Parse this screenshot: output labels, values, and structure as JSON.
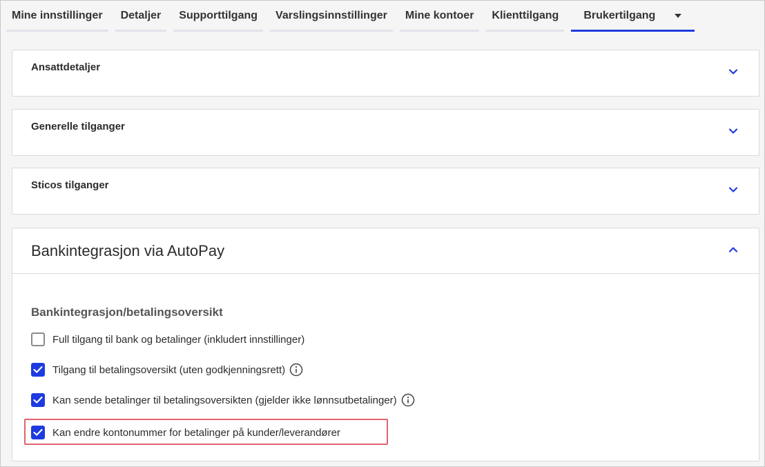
{
  "tabs": [
    {
      "label": "Mine innstillinger"
    },
    {
      "label": "Detaljer"
    },
    {
      "label": "Supporttilgang"
    },
    {
      "label": "Varslingsinnstillinger"
    },
    {
      "label": "Mine kontoer"
    },
    {
      "label": "Klienttilgang"
    },
    {
      "label": "Brukertilgang",
      "active": true
    }
  ],
  "panels": [
    {
      "title": "Ansattdetaljer",
      "expanded": false
    },
    {
      "title": "Generelle tilganger",
      "expanded": false
    },
    {
      "title": "Sticos tilganger",
      "expanded": false
    }
  ],
  "autopay": {
    "title": "Bankintegrasjon via AutoPay",
    "expanded": true,
    "section_title": "Bankintegrasjon/betalingsoversikt",
    "options": [
      {
        "label": "Full tilgang til bank og betalinger (inkludert innstillinger)",
        "checked": false,
        "info": false
      },
      {
        "label": "Tilgang til betalingsoversikt (uten godkjenningsrett)",
        "checked": true,
        "info": true
      },
      {
        "label": "Kan sende betalinger til betalingsoversikten (gjelder ikke lønnsutbetalinger)",
        "checked": true,
        "info": true
      },
      {
        "label": "Kan endre kontonummer for betalinger på kunder/leverandører",
        "checked": true,
        "info": false,
        "highlighted": true
      }
    ]
  },
  "colors": {
    "accent": "#1e3be0",
    "highlight_border": "#e0646e"
  },
  "icons": {
    "tab_dropdown": "caret-down-icon",
    "panel_toggle_collapsed": "chevron-down-icon",
    "panel_toggle_expanded": "chevron-up-icon",
    "info": "info-icon",
    "check": "check-icon"
  }
}
